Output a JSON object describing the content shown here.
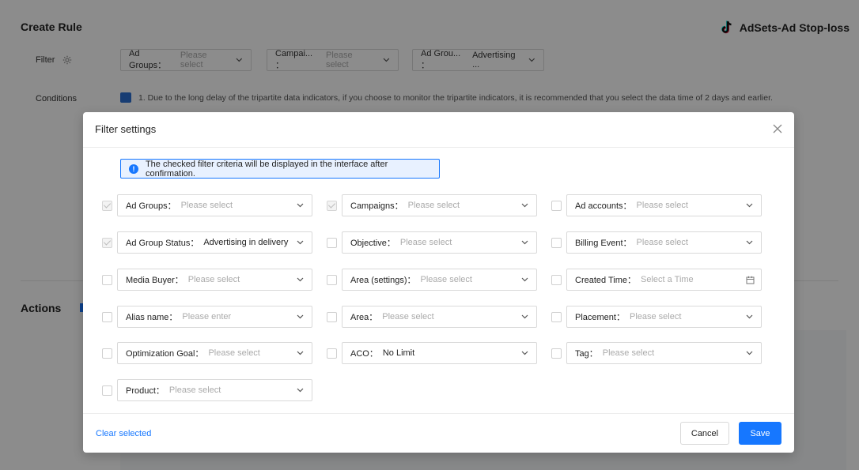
{
  "page": {
    "title": "Create Rule",
    "brand": "AdSets-Ad Stop-loss",
    "filter_label": "Filter",
    "conditions_label": "Conditions",
    "actions_label": "Actions",
    "conditions_note": "1. Due to the long delay of the tripartite data indicators, if you choose to monitor the tripartite indicators, it is recommended that you select the data time of 2 days and earlier.",
    "filter_chips": [
      {
        "label": "Ad Groups：",
        "value": "Please select",
        "placeholder": true
      },
      {
        "label": "Campai... ：",
        "value": "Please select",
        "placeholder": true
      },
      {
        "label": "Ad Grou... ：",
        "value": "Advertising ...",
        "placeholder": false
      }
    ]
  },
  "modal": {
    "title": "Filter settings",
    "notice": "The checked filter criteria will be displayed in the interface after confirmation.",
    "fields": [
      {
        "label": "Ad Groups：",
        "value": "Please select",
        "placeholder": true,
        "checked": true,
        "kind": "select"
      },
      {
        "label": "Campaigns：",
        "value": "Please select",
        "placeholder": true,
        "checked": true,
        "kind": "select"
      },
      {
        "label": "Ad accounts：",
        "value": "Please select",
        "placeholder": true,
        "checked": false,
        "kind": "select"
      },
      {
        "label": "Ad Group Status：",
        "value": "Advertising in delivery",
        "placeholder": false,
        "checked": true,
        "kind": "select"
      },
      {
        "label": "Objective：",
        "value": "Please select",
        "placeholder": true,
        "checked": false,
        "kind": "select"
      },
      {
        "label": "Billing Event：",
        "value": "Please select",
        "placeholder": true,
        "checked": false,
        "kind": "select"
      },
      {
        "label": "Media Buyer：",
        "value": "Please select",
        "placeholder": true,
        "checked": false,
        "kind": "select"
      },
      {
        "label": "Area (settings)：",
        "value": "Please select",
        "placeholder": true,
        "checked": false,
        "kind": "select"
      },
      {
        "label": "Created Time：",
        "value": "Select a Time",
        "placeholder": true,
        "checked": false,
        "kind": "date"
      },
      {
        "label": "Alias name：",
        "value": "Please enter",
        "placeholder": true,
        "checked": false,
        "kind": "select"
      },
      {
        "label": "Area：",
        "value": "Please select",
        "placeholder": true,
        "checked": false,
        "kind": "select"
      },
      {
        "label": "Placement：",
        "value": "Please select",
        "placeholder": true,
        "checked": false,
        "kind": "select"
      },
      {
        "label": "Optimization Goal：",
        "value": "Please select",
        "placeholder": true,
        "checked": false,
        "kind": "select"
      },
      {
        "label": "ACO：",
        "value": "No Limit",
        "placeholder": false,
        "checked": false,
        "kind": "select"
      },
      {
        "label": "Tag：",
        "value": "Please select",
        "placeholder": true,
        "checked": false,
        "kind": "select"
      },
      {
        "label": "Product：",
        "value": "Please select",
        "placeholder": true,
        "checked": false,
        "kind": "select"
      }
    ],
    "footer": {
      "clear_label": "Clear selected",
      "cancel_label": "Cancel",
      "save_label": "Save"
    }
  },
  "colors": {
    "primary": "#1677ff",
    "notice_bg": "#e8f1ff",
    "overlay": "rgba(0,0,0,0.45)"
  },
  "icons": [
    "tiktok-logo-icon",
    "gear-icon",
    "info-icon",
    "close-icon",
    "chevron-down-icon",
    "calendar-icon",
    "checkmark-icon"
  ]
}
